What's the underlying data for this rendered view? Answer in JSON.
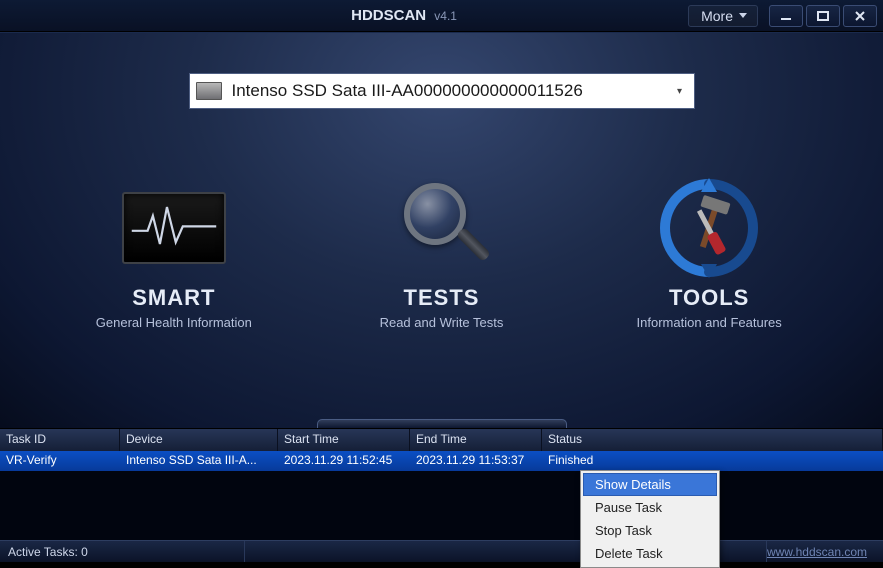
{
  "titlebar": {
    "app_name": "HDDSCAN",
    "version": "v4.1",
    "more_label": "More"
  },
  "drive": {
    "selected": "Intenso SSD Sata III-AA000000000000011526"
  },
  "buttons": {
    "smart": {
      "title": "SMART",
      "subtitle": "General Health Information"
    },
    "tests": {
      "title": "TESTS",
      "subtitle": "Read and Write Tests"
    },
    "tools": {
      "title": "TOOLS",
      "subtitle": "Information and Features"
    }
  },
  "table": {
    "headers": {
      "task": "Task ID",
      "device": "Device",
      "start": "Start Time",
      "end": "End Time",
      "status": "Status"
    },
    "rows": [
      {
        "task": "VR-Verify",
        "device": "Intenso SSD Sata III-A...",
        "start": "2023.11.29 11:52:45",
        "end": "2023.11.29 11:53:37",
        "status": "Finished"
      }
    ]
  },
  "context_menu": {
    "items": [
      "Show Details",
      "Pause Task",
      "Stop Task",
      "Delete Task"
    ],
    "hovered_index": 0
  },
  "statusbar": {
    "active_tasks_label": "Active Tasks: 0",
    "link": "www.hddscan.com"
  }
}
